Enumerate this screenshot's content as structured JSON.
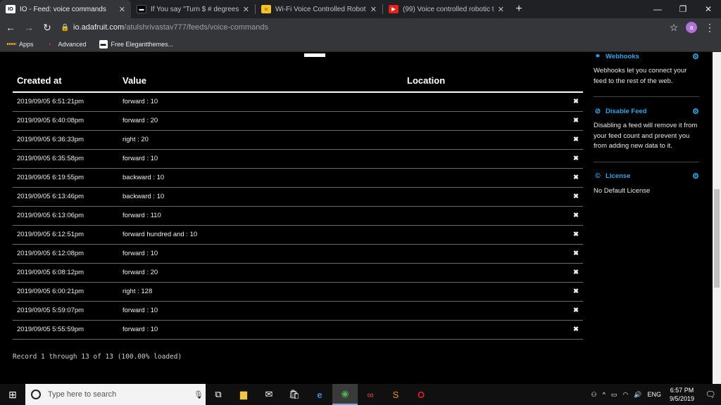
{
  "browser": {
    "tabs": [
      {
        "title": "IO - Feed: voice commands",
        "favicon": "io-logo",
        "active": true
      },
      {
        "title": "If You say \"Turn $ # degrees\", the",
        "favicon": "ifttt-logo",
        "active": false
      },
      {
        "title": "Wi-Fi Voice Controlled Robot Usi",
        "favicon": "instructables-logo",
        "active": false
      },
      {
        "title": "(99) Voice controlled robotic tank",
        "favicon": "youtube-logo",
        "active": false
      }
    ],
    "url_host": "io.adafruit.com",
    "url_path": "/atulshrivastav777/feeds/voice-commands",
    "avatar_letter": "a",
    "bookmarks": [
      {
        "label": "Apps"
      },
      {
        "label": "Advanced"
      },
      {
        "label": "Free Elegantthemes..."
      }
    ]
  },
  "table": {
    "headers": {
      "created": "Created at",
      "value": "Value",
      "location": "Location"
    },
    "rows": [
      {
        "created": "2019/09/05 6:51:21pm",
        "value": "forward : 10"
      },
      {
        "created": "2019/09/05 6:40:08pm",
        "value": "forward : 20"
      },
      {
        "created": "2019/09/05 6:36:33pm",
        "value": "right : 20"
      },
      {
        "created": "2019/09/05 6:35:58pm",
        "value": "forward : 10"
      },
      {
        "created": "2019/09/05 6:19:55pm",
        "value": "backward : 10"
      },
      {
        "created": "2019/09/05 6:13:46pm",
        "value": "backward : 10"
      },
      {
        "created": "2019/09/05 6:13:06pm",
        "value": "forward : 110"
      },
      {
        "created": "2019/09/05 6:12:51pm",
        "value": "forward hundred and : 10"
      },
      {
        "created": "2019/09/05 6:12:08pm",
        "value": "forward : 10"
      },
      {
        "created": "2019/09/05 6:08:12pm",
        "value": "forward : 20"
      },
      {
        "created": "2019/09/05 6:00:21pm",
        "value": "right : 128"
      },
      {
        "created": "2019/09/05 5:59:07pm",
        "value": "forward : 10"
      },
      {
        "created": "2019/09/05 5:55:59pm",
        "value": "forward : 10"
      }
    ],
    "delete_glyph": "✖",
    "status": "Record 1 through 13 of 13 (100.00% loaded)"
  },
  "sidebar": {
    "webhooks": {
      "title": "Webhooks",
      "text": "Webhooks let you connect your feed to the rest of the web."
    },
    "disable": {
      "title": "Disable Feed",
      "text": "Disabling a feed will remove it from your feed count and prevent you from adding new data to it."
    },
    "license": {
      "title": "License",
      "text": "No Default License"
    }
  },
  "taskbar": {
    "search_placeholder": "Type here to search",
    "language": "ENG",
    "time": "6:57 PM",
    "date": "9/5/2019"
  },
  "colors": {
    "accent": "#2aa8ea",
    "delete": "#e8262a"
  }
}
